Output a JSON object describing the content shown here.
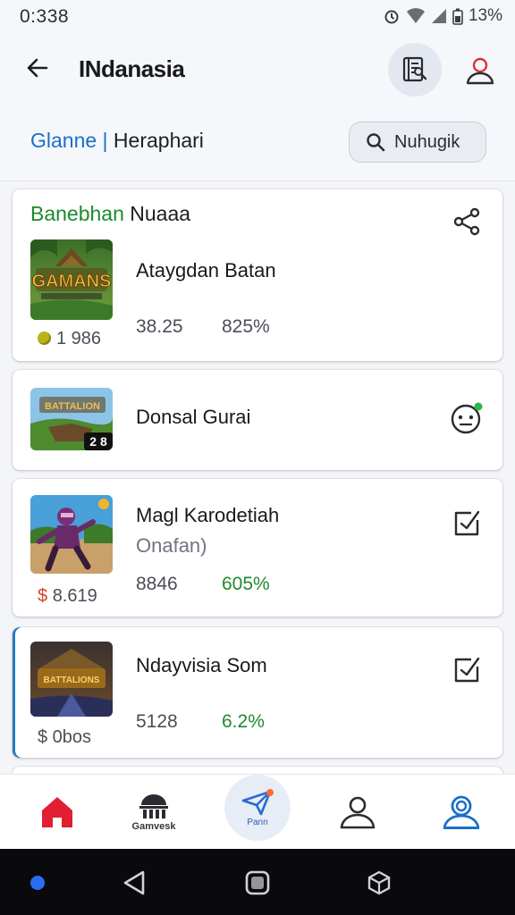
{
  "status_bar": {
    "time": "0:338",
    "battery": "13%"
  },
  "app_bar": {
    "title": "INdanasia"
  },
  "filter": {
    "title_blue": "Glanne |",
    "title_dark": "Heraphari",
    "search_label": "Nuhugik"
  },
  "cards": [
    {
      "header_green": "Banebhan",
      "header_dark": "Nuaaa",
      "thumb_text": "GAMANS",
      "name": "Ataygdan Batan",
      "stat1": "38.25",
      "stat2": "825%",
      "price": "1 986"
    },
    {
      "thumb_text": "BATTALION",
      "thumb_badge": "2 8",
      "name": "Donsal Gurai"
    },
    {
      "name": "Magl Karodetiah",
      "subtitle": "Onafan)",
      "stat1": "8846",
      "stat2": "605%",
      "price_symbol": "$",
      "price": "8.619"
    },
    {
      "thumb_text": "BATTALIONS",
      "name": "Ndayvisia Som",
      "stat1": "5128",
      "stat2": "6.2%",
      "price": "$ 0bos"
    }
  ],
  "bottom_nav": {
    "games_label": "Gamvesk",
    "center_label": "Pann"
  },
  "colors": {
    "accent_blue": "#1a6fc9",
    "green": "#1f8a2c",
    "home_red": "#e01f32",
    "nav_dot": "#ff6b2e"
  }
}
